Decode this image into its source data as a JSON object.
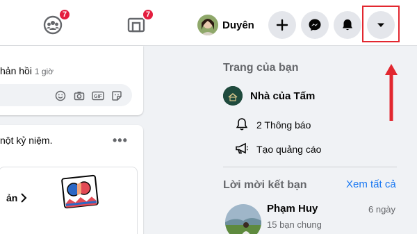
{
  "topbar": {
    "groups_badge": "7",
    "gaming_badge": "7",
    "profile_name": "Duyên"
  },
  "feed": {
    "reply_text": "hản hồi",
    "reply_time": "1 giờ",
    "memory_text": "nột kỷ niệm.",
    "memory_link": "ản"
  },
  "sidebar": {
    "pages_title": "Trang của bạn",
    "page_name": "Nhà của Tấm",
    "notifications": "2 Thông báo",
    "create_ad": "Tạo quảng cáo",
    "friend_requests_title": "Lời mời kết bạn",
    "see_all": "Xem tất cả",
    "friend": {
      "name": "Phạm Huy",
      "mutual": "15 bạn chung",
      "time": "6 ngày"
    }
  },
  "colors": {
    "accent": "#1877f2",
    "badge": "#e41e3f",
    "annotation": "#e2272f"
  },
  "icons": [
    "groups-icon",
    "gaming-icon",
    "plus-icon",
    "messenger-icon",
    "bell-icon",
    "caret-down-icon",
    "emoji-icon",
    "camera-icon",
    "gif-icon",
    "sticker-icon",
    "megaphone-icon"
  ]
}
